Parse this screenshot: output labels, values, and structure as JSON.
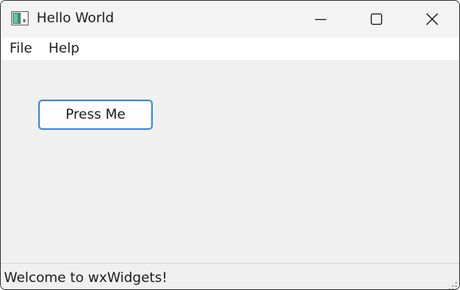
{
  "window": {
    "title": "Hello World",
    "icon": "app-window-icon",
    "controls": {
      "minimize_icon": "minimize-icon",
      "maximize_icon": "maximize-icon",
      "close_icon": "close-icon"
    }
  },
  "menubar": {
    "items": [
      {
        "label": "File"
      },
      {
        "label": "Help"
      }
    ]
  },
  "main": {
    "button_label": "Press Me"
  },
  "statusbar": {
    "text": "Welcome to wxWidgets!",
    "grip_icon": "resize-grip-icon"
  },
  "colors": {
    "button_border": "#3d8ad6",
    "client_background": "#f0f0f0",
    "menubar_background": "#ffffff"
  }
}
